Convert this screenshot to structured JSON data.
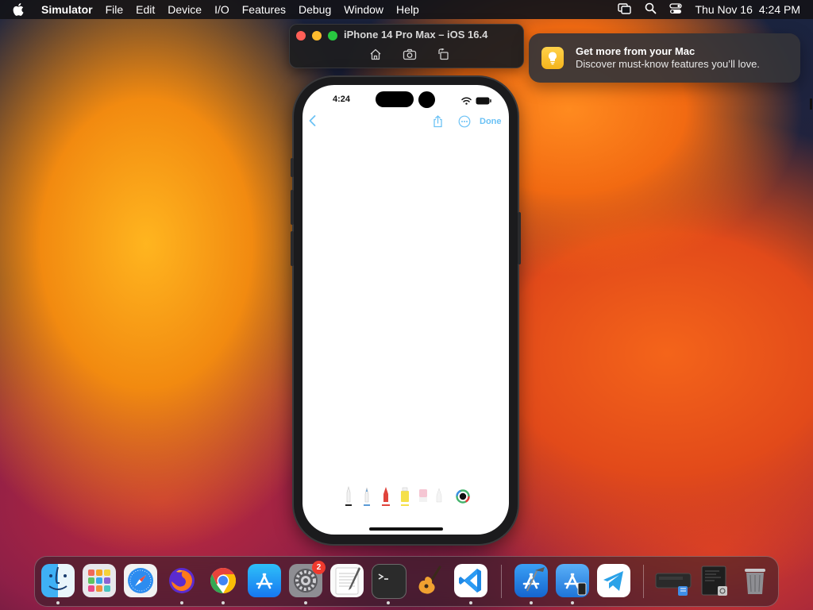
{
  "menubar": {
    "app_name": "Simulator",
    "menus": [
      "File",
      "Edit",
      "Device",
      "I/O",
      "Features",
      "Debug",
      "Window",
      "Help"
    ],
    "date": "Thu Nov 16",
    "time": "4:24 PM",
    "icons": [
      "apple-icon",
      "screen-mirroring-icon",
      "spotlight-search-icon",
      "control-center-icon"
    ]
  },
  "simulator": {
    "title": "iPhone 14 Pro Max – iOS 16.4",
    "tools": [
      "home-icon",
      "screenshot-icon",
      "rotate-icon"
    ]
  },
  "notification": {
    "title": "Get more from your Mac",
    "body": "Discover must-know features you’ll love.",
    "icon": "lightbulb-icon"
  },
  "phone": {
    "status_time": "4:24",
    "done_label": "Done",
    "accent": "#6cc2f5",
    "markup_tools": [
      "pen-tool",
      "marker-tool",
      "red-pen-tool",
      "highlighter-tool",
      "eraser-tool",
      "pencil-tool",
      "color-picker"
    ]
  },
  "dock": {
    "apps": [
      "Finder",
      "Launchpad",
      "Safari",
      "Firefox",
      "Google Chrome",
      "App Store",
      "System Settings",
      "TextEdit",
      "Terminal",
      "GarageBand",
      "Visual Studio Code",
      "Xcode",
      "Simulator",
      "Telegram"
    ],
    "system_settings_badge": "2",
    "folders": [
      "Downloads",
      "Screenshots",
      "Trash"
    ]
  }
}
